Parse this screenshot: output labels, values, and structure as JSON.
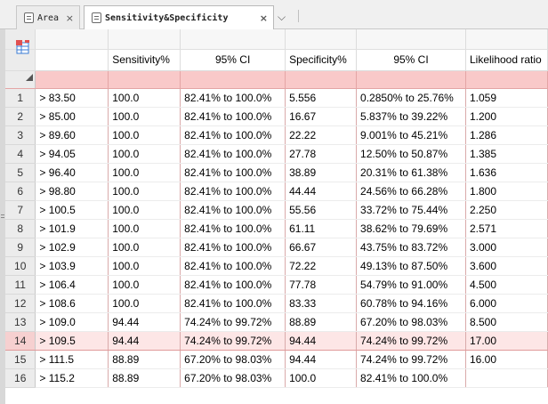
{
  "tabs": [
    {
      "label": "Area",
      "icon": "sheet-icon",
      "close": "×"
    },
    {
      "label": "Sensitivity&Specificity",
      "icon": "sheet-icon",
      "close": "×"
    }
  ],
  "tab_overflow_icon": "chevron-down-icon",
  "tab_overflow_glyph": "⌵",
  "grid": {
    "columns": [
      "",
      "Sensitivity%",
      "95% CI",
      "Specificity%",
      "95% CI",
      "Likelihood ratio"
    ],
    "rows": [
      {
        "num": "1",
        "criterion": "> 83.50",
        "sensitivity": "100.0",
        "ci1": "82.41% to 100.0%",
        "specificity": "5.556",
        "ci2": "0.2850% to 25.76%",
        "lr": "1.059"
      },
      {
        "num": "2",
        "criterion": "> 85.00",
        "sensitivity": "100.0",
        "ci1": "82.41% to 100.0%",
        "specificity": "16.67",
        "ci2": "5.837% to 39.22%",
        "lr": "1.200"
      },
      {
        "num": "3",
        "criterion": "> 89.60",
        "sensitivity": "100.0",
        "ci1": "82.41% to 100.0%",
        "specificity": "22.22",
        "ci2": "9.001% to 45.21%",
        "lr": "1.286"
      },
      {
        "num": "4",
        "criterion": "> 94.05",
        "sensitivity": "100.0",
        "ci1": "82.41% to 100.0%",
        "specificity": "27.78",
        "ci2": "12.50% to 50.87%",
        "lr": "1.385"
      },
      {
        "num": "5",
        "criterion": "> 96.40",
        "sensitivity": "100.0",
        "ci1": "82.41% to 100.0%",
        "specificity": "38.89",
        "ci2": "20.31% to 61.38%",
        "lr": "1.636"
      },
      {
        "num": "6",
        "criterion": "> 98.80",
        "sensitivity": "100.0",
        "ci1": "82.41% to 100.0%",
        "specificity": "44.44",
        "ci2": "24.56% to 66.28%",
        "lr": "1.800"
      },
      {
        "num": "7",
        "criterion": "> 100.5",
        "sensitivity": "100.0",
        "ci1": "82.41% to 100.0%",
        "specificity": "55.56",
        "ci2": "33.72% to 75.44%",
        "lr": "2.250"
      },
      {
        "num": "8",
        "criterion": "> 101.9",
        "sensitivity": "100.0",
        "ci1": "82.41% to 100.0%",
        "specificity": "61.11",
        "ci2": "38.62% to 79.69%",
        "lr": "2.571"
      },
      {
        "num": "9",
        "criterion": "> 102.9",
        "sensitivity": "100.0",
        "ci1": "82.41% to 100.0%",
        "specificity": "66.67",
        "ci2": "43.75% to 83.72%",
        "lr": "3.000"
      },
      {
        "num": "10",
        "criterion": "> 103.9",
        "sensitivity": "100.0",
        "ci1": "82.41% to 100.0%",
        "specificity": "72.22",
        "ci2": "49.13% to 87.50%",
        "lr": "3.600"
      },
      {
        "num": "11",
        "criterion": "> 106.4",
        "sensitivity": "100.0",
        "ci1": "82.41% to 100.0%",
        "specificity": "77.78",
        "ci2": "54.79% to 91.00%",
        "lr": "4.500"
      },
      {
        "num": "12",
        "criterion": "> 108.6",
        "sensitivity": "100.0",
        "ci1": "82.41% to 100.0%",
        "specificity": "83.33",
        "ci2": "60.78% to 94.16%",
        "lr": "6.000"
      },
      {
        "num": "13",
        "criterion": "> 109.0",
        "sensitivity": "94.44",
        "ci1": "74.24% to 99.72%",
        "specificity": "88.89",
        "ci2": "67.20% to 98.03%",
        "lr": "8.500"
      },
      {
        "num": "14",
        "criterion": "> 109.5",
        "sensitivity": "94.44",
        "ci1": "74.24% to 99.72%",
        "specificity": "94.44",
        "ci2": "74.24% to 99.72%",
        "lr": "17.00"
      },
      {
        "num": "15",
        "criterion": "> 111.5",
        "sensitivity": "88.89",
        "ci1": "67.20% to 98.03%",
        "specificity": "94.44",
        "ci2": "74.24% to 99.72%",
        "lr": "16.00"
      },
      {
        "num": "16",
        "criterion": "> 115.2",
        "sensitivity": "88.89",
        "ci1": "67.20% to 98.03%",
        "specificity": "100.0",
        "ci2": "82.41% to 100.0%",
        "lr": ""
      }
    ],
    "selected_row": "14"
  },
  "colors": {
    "filter_row": "#f9c9c9",
    "selected_row": "#fde6e6",
    "column_divider": "#d9aaaa",
    "corner_icon_red": "#e05050",
    "corner_icon_blue": "#3a7bd5"
  }
}
